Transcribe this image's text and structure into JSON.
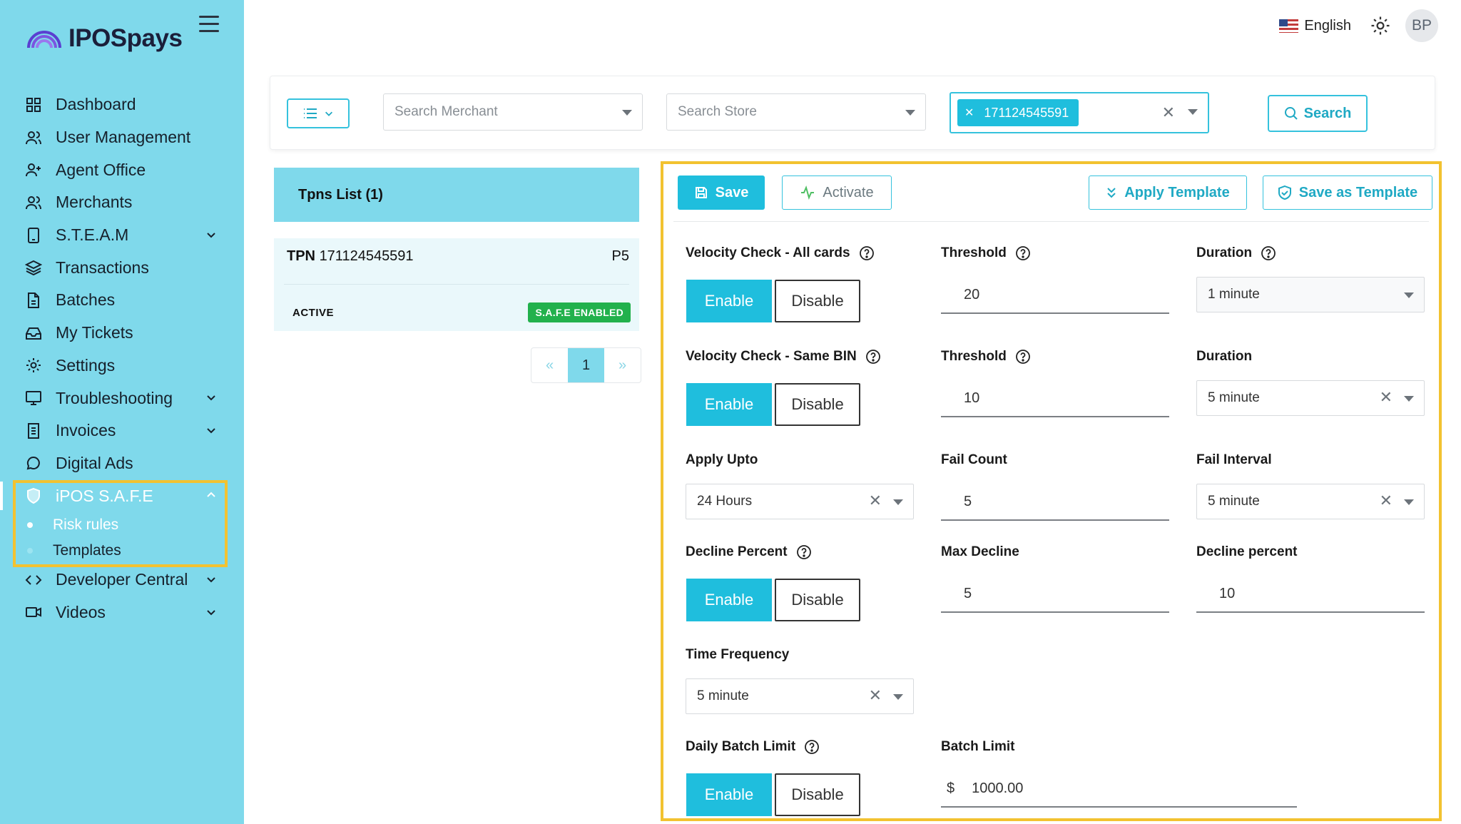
{
  "brand": {
    "name": "IPOSpays"
  },
  "sidebar": {
    "items": [
      {
        "label": "Dashboard",
        "icon": "dashboard-grid-icon"
      },
      {
        "label": "User Management",
        "icon": "users-icon"
      },
      {
        "label": "Agent Office",
        "icon": "user-plus-icon"
      },
      {
        "label": "Merchants",
        "icon": "users-icon"
      },
      {
        "label": "S.T.E.A.M",
        "icon": "device-icon",
        "expandable": true
      },
      {
        "label": "Transactions",
        "icon": "layers-icon"
      },
      {
        "label": "Batches",
        "icon": "document-icon"
      },
      {
        "label": "My Tickets",
        "icon": "inbox-icon"
      },
      {
        "label": "Settings",
        "icon": "gear-icon"
      },
      {
        "label": "Troubleshooting",
        "icon": "monitor-icon",
        "expandable": true
      },
      {
        "label": "Invoices",
        "icon": "invoice-icon",
        "expandable": true
      },
      {
        "label": "Digital Ads",
        "icon": "chat-bubble-icon"
      },
      {
        "label": "iPOS S.A.F.E",
        "icon": "shield-icon",
        "expandable": true,
        "active": true
      },
      {
        "label": "Developer Central",
        "icon": "code-icon",
        "expandable": true
      },
      {
        "label": "Videos",
        "icon": "video-icon",
        "expandable": true
      }
    ],
    "safe_sub": [
      {
        "label": "Risk rules"
      },
      {
        "label": "Templates"
      }
    ]
  },
  "topbar": {
    "language": "English",
    "avatar_initials": "BP"
  },
  "filters": {
    "merchant_placeholder": "Search Merchant",
    "store_placeholder": "Search Store",
    "tpn_selected": "171124545591",
    "search_label": "Search"
  },
  "tpn_list": {
    "title": "Tpns List (1)",
    "item": {
      "tpn_prefix": "TPN",
      "tpn": "171124545591",
      "code": "P5",
      "status": "ACTIVE",
      "badge": "S.A.F.E ENABLED"
    },
    "pager": {
      "prev": "«",
      "page": "1",
      "next": "»"
    }
  },
  "form": {
    "toolbar": {
      "save": "Save",
      "activate": "Activate",
      "apply_template": "Apply Template",
      "save_as_template": "Save as Template"
    },
    "enable_label": "Enable",
    "disable_label": "Disable",
    "velocity_all": {
      "label": "Velocity Check - All cards",
      "threshold_label": "Threshold",
      "threshold": "20",
      "duration_label": "Duration",
      "duration": "1 minute"
    },
    "velocity_bin": {
      "label": "Velocity Check - Same BIN",
      "threshold_label": "Threshold",
      "threshold": "10",
      "duration_label": "Duration",
      "duration": "5 minute"
    },
    "apply_upto": {
      "label": "Apply Upto",
      "value": "24 Hours",
      "fail_count_label": "Fail Count",
      "fail_count": "5",
      "fail_interval_label": "Fail Interval",
      "fail_interval": "5 minute"
    },
    "decline_percent": {
      "label": "Decline Percent",
      "max_decline_label": "Max Decline",
      "max_decline": "5",
      "decline_percent_label": "Decline percent",
      "decline_percent": "10"
    },
    "time_frequency": {
      "label": "Time Frequency",
      "value": "5 minute"
    },
    "daily_batch": {
      "label": "Daily Batch Limit",
      "batch_limit_label": "Batch Limit",
      "currency": "$",
      "batch_limit": "1000.00"
    }
  },
  "colors": {
    "accent": "#1fbedd",
    "sidebar": "#7fd9eb",
    "highlight": "#f2c230",
    "badge": "#22b14c"
  }
}
